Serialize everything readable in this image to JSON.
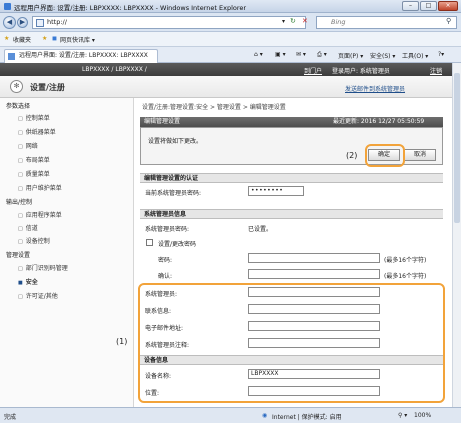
{
  "window": {
    "title": "远程用户界面: 设置/注册: LBPXXXX: LBPXXXX - Windows Internet Explorer",
    "min": "–",
    "max": "□",
    "close": "×"
  },
  "address": {
    "url": "http://",
    "search_placeholder": "Bing"
  },
  "favorites": {
    "label": "收藏夹",
    "gallery": "网页快讯库 ▾"
  },
  "tab": {
    "label": "远程用户界面: 设置/注册: LBPXXXX: LBPXXXX"
  },
  "tab_tools": {
    "page": "页面(P) ▾",
    "safety": "安全(S) ▾",
    "tools": "工具(O) ▾",
    "help": "?▾"
  },
  "header": {
    "product": "LBPXXXX / LBPXXXX /",
    "portal": "到门户",
    "login_user": "登录用户: 系统管理员",
    "logout": "注销"
  },
  "brand": {
    "title": "设置/注册",
    "mail_admin": "发送邮件到系统管理员"
  },
  "sidebar": {
    "pref_heading": "参数选择",
    "pref_items": [
      "控制菜单",
      "供纸器菜单",
      "网络",
      "布局菜单",
      "质量菜单",
      "用户维护菜单"
    ],
    "io_heading": "输出/控制",
    "io_items": [
      "应用程序菜单",
      "信道",
      "设备控制"
    ],
    "mgmt_heading": "管理设置",
    "mgmt_items": [
      "部门识别码管理",
      "安全",
      "许可证/其他"
    ]
  },
  "breadcrumb": "设置/注册:管理设置:安全 > 管理设置 > 编辑管理设置",
  "edit": {
    "title": "编辑管理设置",
    "last_updated": "最近更新: 2016 12/27 05:50:59",
    "message": "设置将做如下更改。",
    "ok": "确定",
    "cancel": "取消"
  },
  "auth": {
    "heading": "编辑管理设置的认证",
    "pw_label": "当前系统管理员密码:",
    "pw_value": "••••••••"
  },
  "admin": {
    "heading": "系统管理员信息",
    "pw_label": "系统管理员密码:",
    "pw_status": "已设置。",
    "change_pw": "设置/更改密码",
    "password": "密码:",
    "confirm": "确认:",
    "hint": "(最多16个字符)",
    "name_label": "系统管理员:",
    "contact_label": "联系信息:",
    "email_label": "电子邮件地址:",
    "comment_label": "系统管理员注释:"
  },
  "device": {
    "heading": "设备信息",
    "name_label": "设备名称:",
    "name_value": "LBPXXXX",
    "location_label": "位置:"
  },
  "callouts": {
    "one": "(1)",
    "two": "(2)"
  },
  "status": {
    "left": "完成",
    "zone": "Internet | 保护模式: 启用",
    "zoom": "100%"
  }
}
